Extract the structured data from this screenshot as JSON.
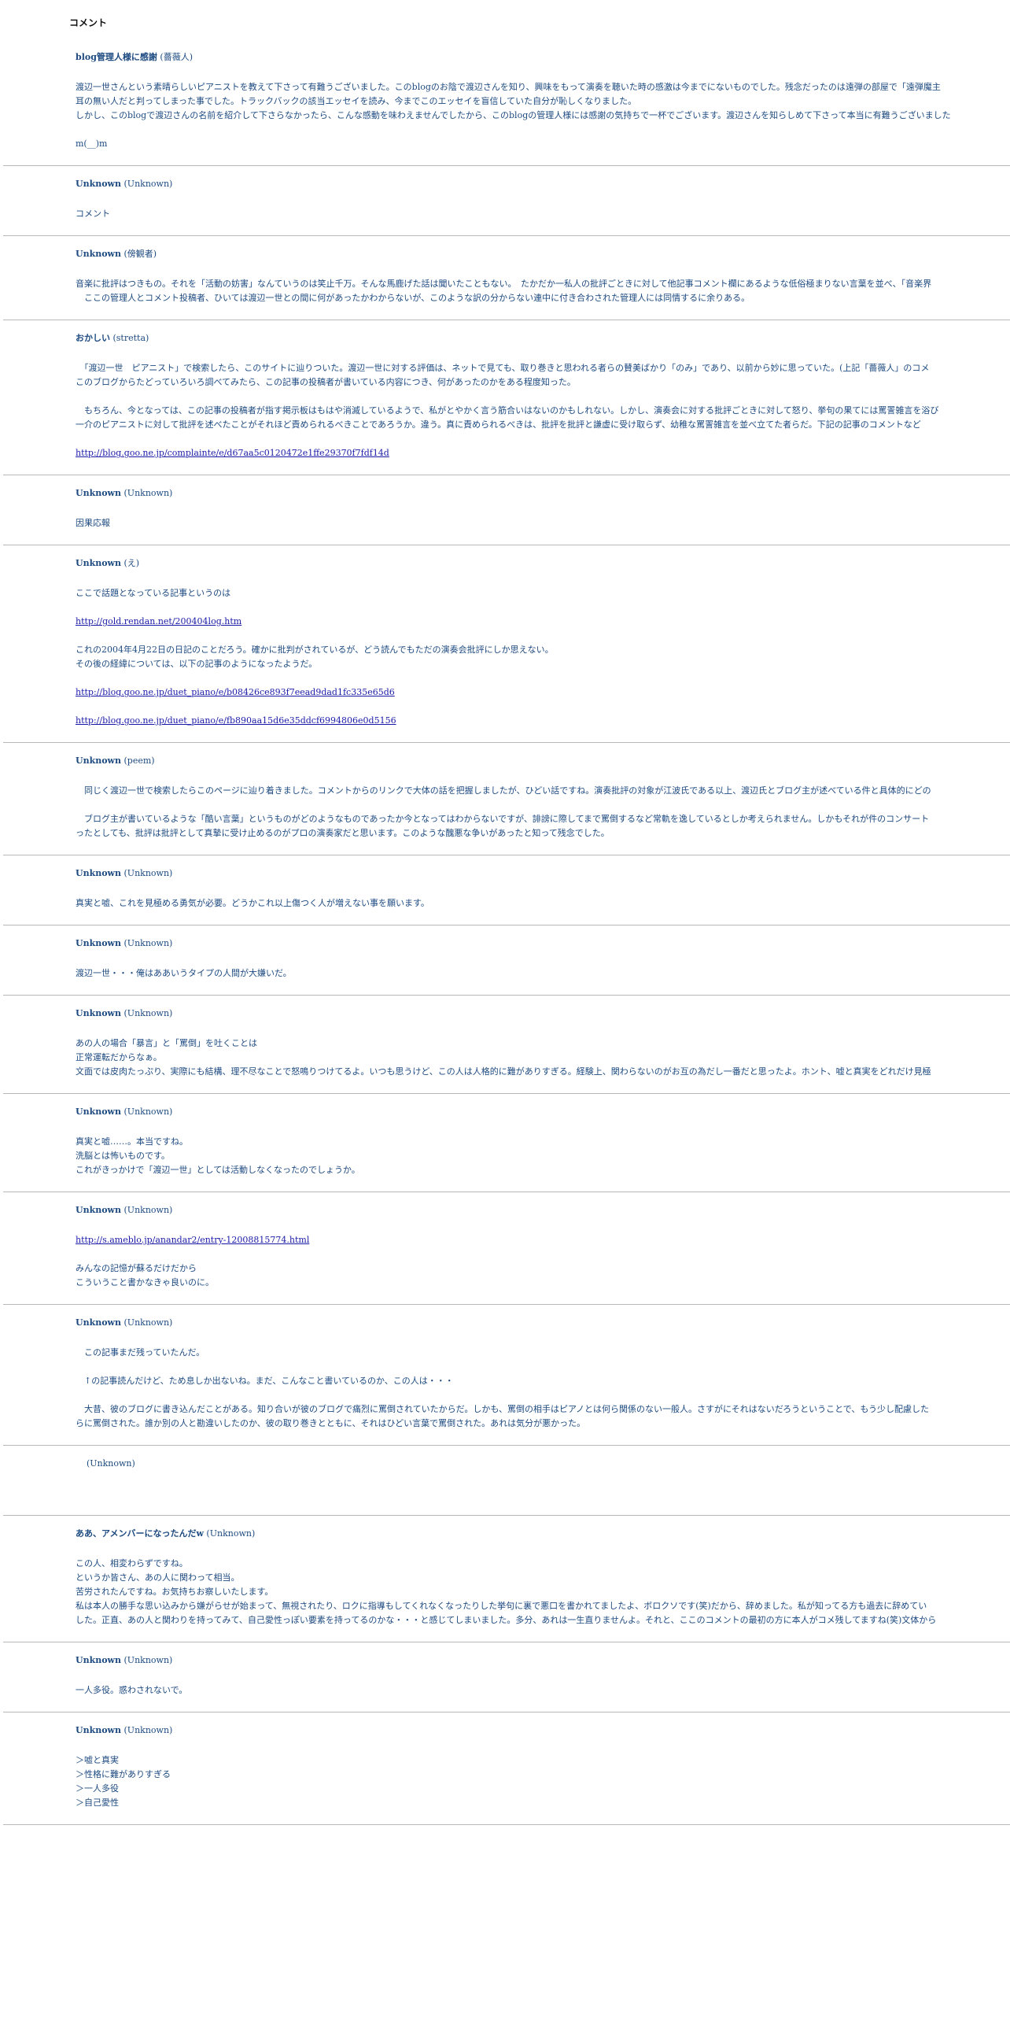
{
  "section_title": "コメント",
  "comments": [
    {
      "author": "blog管理人様に感謝",
      "name": "(薔薇人)",
      "paragraphs": [
        [
          "渡辺一世さんという素晴らしいピアニストを教えて下さって有難うございました。このblogのお陰で渡辺さんを知り、興味をもって演奏を聴いた時の感激は今までにないものでした。残念だったのは遠弾の部屋で「遠弾魔主",
          "耳の無い人だと判ってしまった事でした。トラックバックの該当エッセイを読み、今までこのエッセイを盲信していた自分が恥しくなりました。",
          "しかし、このblogで渡辺さんの名前を紹介して下さらなかったら、こんな感動を味わえませんでしたから、このblogの管理人様には感謝の気持ちで一杯でございます。渡辺さんを知らしめて下さって本当に有難うございました"
        ],
        [
          "m(__)m"
        ]
      ]
    },
    {
      "author": "Unknown",
      "name": "(Unknown)",
      "paragraphs": [
        [
          "コメント"
        ]
      ]
    },
    {
      "author": "Unknown",
      "name": "(傍観者)",
      "paragraphs": [
        [
          "音楽に批評はつきもの。それを「活動の妨害」なんていうのは笑止千万。そんな馬鹿げた話は聞いたこともない。　たかだか一私人の批評ごときに対して他記事コメント欄にあるような低俗極まりない言葉を並べ、「音楽界",
          "　ここの管理人とコメント投稿者、ひいては渡辺一世との間に何があったかわからないが、このような訳の分からない連中に付き合わされた管理人には同情するに余りある。"
        ]
      ]
    },
    {
      "author": "おかしい",
      "name": "(stretta)",
      "paragraphs": [
        [
          "　「渡辺一世　ピアニスト」で検索したら、このサイトに辿りついた。渡辺一世に対する評価は、ネットで見ても、取り巻きと思われる者らの賛美ばかり「のみ」であり、以前から妙に思っていた。(上記「薔薇人」のコメ",
          "このブログからたどっていろいろ調べてみたら、この記事の投稿者が書いている内容につき、何があったのかをある程度知った。"
        ],
        [
          "　もちろん、今となっては、この記事の投稿者が指す掲示板はもはや消滅しているようで、私がとやかく言う筋合いはないのかもしれない。しかし、演奏会に対する批評ごときに対して怒り、挙句の果てには罵詈雑言を浴び",
          "一介のピアニストに対して批評を述べたことがそれほど責められるべきことであろうか。違う。真に責められるべきは、批評を批評と謙虚に受け取らず、幼稚な罵詈雑言を並べ立てた者らだ。下記の記事のコメントなど"
        ],
        [
          {
            "link": "http://blog.goo.ne.jp/complainte/e/d67aa5c0120472e1ffe29370f7fdf14d"
          }
        ]
      ]
    },
    {
      "author": "Unknown",
      "name": "(Unknown)",
      "paragraphs": [
        [
          "因果応報"
        ]
      ]
    },
    {
      "author": "Unknown",
      "name": "(え)",
      "paragraphs": [
        [
          "ここで話題となっている記事というのは"
        ],
        [
          {
            "link": "http://gold.rendan.net/200404log.htm"
          }
        ],
        [
          "これの2004年4月22日の日記のことだろう。確かに批判がされているが、どう読んでもただの演奏会批評にしか思えない。",
          "その後の経緯については、以下の記事のようになったようだ。"
        ],
        [
          {
            "link": "http://blog.goo.ne.jp/duet_piano/e/b08426ce893f7eead9dad1fc335e65d6"
          }
        ],
        [
          {
            "link": "http://blog.goo.ne.jp/duet_piano/e/fb890aa15d6e35ddcf6994806e0d5156"
          }
        ]
      ]
    },
    {
      "author": "Unknown",
      "name": "(peem)",
      "paragraphs": [
        [
          "　同じく渡辺一世で検索したらこのページに辿り着きました。コメントからのリンクで大体の話を把握しましたが、ひどい話ですね。演奏批評の対象が江波氏である以上、渡辺氏とブログ主が述べている件と具体的にどの"
        ],
        [
          "　ブログ主が書いているような「酷い言葉」というものがどのようなものであったか今となってはわからないですが、誹謗に際してまで罵倒するなど常軌を逸しているとしか考えられません。しかもそれが件のコンサート",
          "ったとしても、批評は批評として真摯に受け止めるのがプロの演奏家だと思います。このような醜悪な争いがあったと知って残念でした。"
        ]
      ]
    },
    {
      "author": "Unknown",
      "name": "(Unknown)",
      "paragraphs": [
        [
          "真実と嘘、これを見極める勇気が必要。どうかこれ以上傷つく人が増えない事を願います。"
        ]
      ]
    },
    {
      "author": "Unknown",
      "name": "(Unknown)",
      "paragraphs": [
        [
          "渡辺一世・・・俺はああいうタイプの人間が大嫌いだ。"
        ]
      ]
    },
    {
      "author": "Unknown",
      "name": "(Unknown)",
      "paragraphs": [
        [
          "あの人の場合「暴言」と「罵倒」を吐くことは",
          "正常運転だからなぁ。",
          "文面では皮肉たっぷり、実際にも結構、理不尽なことで怒鳴りつけてるよ。いつも思うけど、この人は人格的に難がありすぎる。経験上、関わらないのがお互の為だし一番だと思ったよ。ホント、嘘と真実をどれだけ見極"
        ]
      ]
    },
    {
      "author": "Unknown",
      "name": "(Unknown)",
      "paragraphs": [
        [
          "真実と嘘……。本当ですね。",
          "洗脳とは怖いものです。",
          "これがきっかけで「渡辺一世」としては活動しなくなったのでしょうか。"
        ]
      ]
    },
    {
      "author": "Unknown",
      "name": "(Unknown)",
      "paragraphs": [
        [
          {
            "link": "http://s.ameblo.jp/anandar2/entry-12008815774.html"
          }
        ],
        [
          "みんなの記憶が蘇るだけだから",
          "こういうこと書かなきゃ良いのに。"
        ]
      ]
    },
    {
      "author": "Unknown",
      "name": "(Unknown)",
      "paragraphs": [
        [
          "　この記事まだ残っていたんだ。"
        ],
        [
          "　↑の記事読んだけど、ため息しか出ないね。まだ、こんなこと書いているのか、この人は・・・"
        ],
        [
          "　大昔、彼のブログに書き込んだことがある。知り合いが彼のブログで痛烈に罵倒されていたからだ。しかも、罵倒の相手はピアノとは何ら関係のない一般人。さすがにそれはないだろうということで、もう少し配慮した",
          "らに罵倒された。誰か別の人と勘違いしたのか、彼の取り巻きとともに、それはひどい言葉で罵倒された。あれは気分が悪かった。"
        ]
      ]
    },
    {
      "author": "",
      "name": "(Unknown)",
      "paragraphs": [
        [
          ""
        ]
      ]
    },
    {
      "author": "ああ、アメンバーになったんだw",
      "name": "(Unknown)",
      "paragraphs": [
        [
          "この人、相変わらずですね。",
          "というか皆さん、あの人に関わって相当。",
          "苦労されたんですね。お気持ちお察しいたします。",
          "私は本人の勝手な思い込みから嫌がらせが始まって、無視されたり、ロクに指導もしてくれなくなったりした挙句に裏で悪口を書かれてましたよ、ボロクソです(笑)だから、辞めました。私が知ってる方も過去に辞めてい",
          "した。正直、あの人と関わりを持ってみて、自己愛性っぽい要素を持ってるのかな・・・と感じてしまいました。多分、あれは一生直りませんよ。それと、ここのコメントの最初の方に本人がコメ残してますね(笑)文体から"
        ]
      ]
    },
    {
      "author": "Unknown",
      "name": "(Unknown)",
      "paragraphs": [
        [
          "一人多役。惑わされないで。"
        ]
      ]
    },
    {
      "author": "Unknown",
      "name": "(Unknown)",
      "paragraphs": [
        [
          "＞嘘と真実",
          "＞性格に難がありすぎる",
          "＞一人多役",
          "＞自己愛性"
        ]
      ]
    }
  ]
}
